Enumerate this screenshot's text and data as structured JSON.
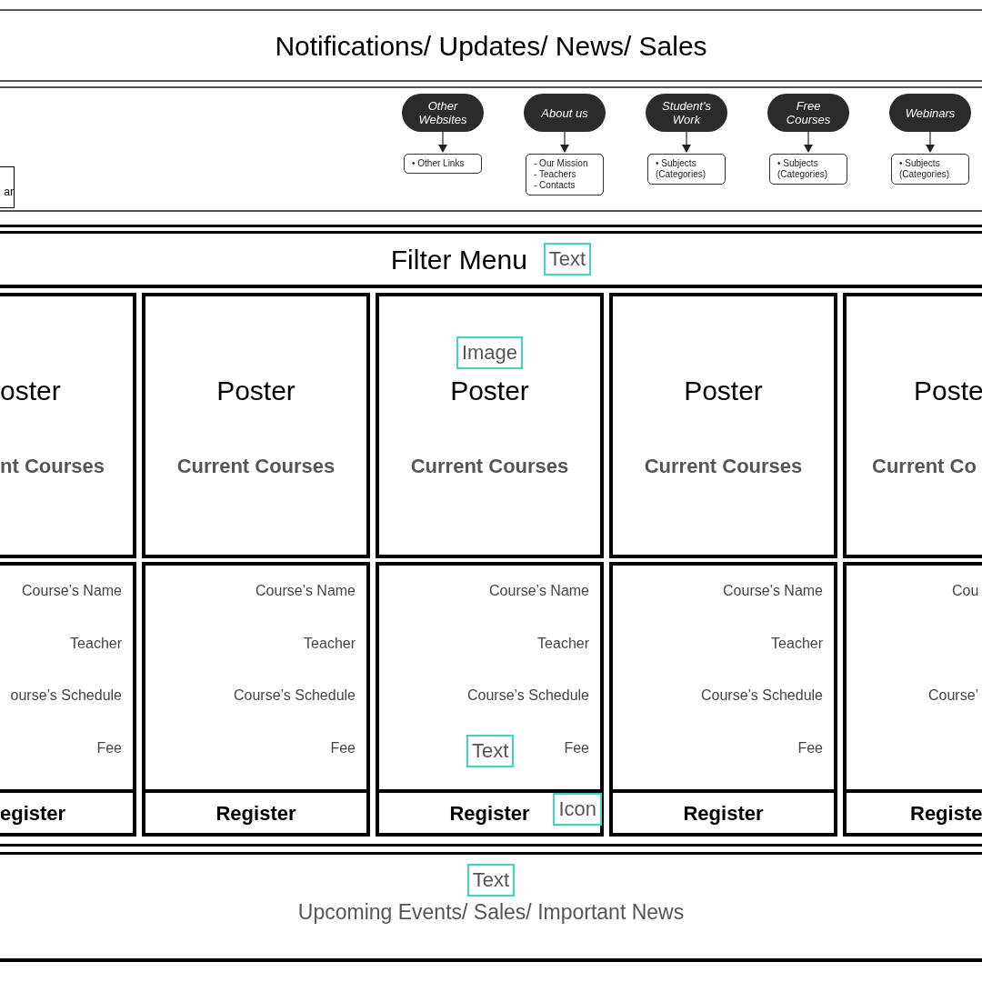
{
  "header": {
    "title": "Notifications/ Updates/ News/ Sales"
  },
  "nav": {
    "left_box": {
      "text": "ar"
    },
    "items": [
      {
        "title": "Other Websites",
        "lines": [
          "• Other Links"
        ]
      },
      {
        "title": "About us",
        "lines": [
          "- Our Mission",
          "- Teachers",
          "- Contacts"
        ]
      },
      {
        "title": "Student's Work",
        "lines": [
          "• Subjects (Categories)"
        ]
      },
      {
        "title": "Free Courses",
        "lines": [
          "• Subjects (Categories)"
        ]
      },
      {
        "title": "Webinars",
        "lines": [
          "• Subjects (Categories)"
        ]
      }
    ]
  },
  "filter": {
    "title": "Filter Menu",
    "note": "Text"
  },
  "cards": [
    {
      "kind": "cut_left",
      "poster": "oster",
      "subtitle": "nt Courses",
      "details": [
        {
          "kind": "name",
          "text": "Course’s Name"
        },
        {
          "kind": "teacher",
          "text": "Teacher"
        },
        {
          "kind": "schedule",
          "text": "ourse’s Schedule"
        },
        {
          "kind": "fee",
          "text": "Fee"
        }
      ],
      "button": "egister"
    },
    {
      "kind": "full",
      "poster": "Poster",
      "subtitle": "Current Courses",
      "details": [
        {
          "kind": "name",
          "text": "Course’s Name"
        },
        {
          "kind": "teacher",
          "text": "Teacher"
        },
        {
          "kind": "schedule",
          "text": "Course’s Schedule"
        },
        {
          "kind": "fee",
          "text": "Fee"
        }
      ],
      "button": "Register"
    },
    {
      "kind": "full",
      "poster": "Poster",
      "subtitle": "Current Courses",
      "details": [
        {
          "kind": "name",
          "text": "Course’s Name"
        },
        {
          "kind": "teacher",
          "text": "Teacher"
        },
        {
          "kind": "schedule",
          "text": "Course’s Schedule"
        },
        {
          "kind": "fee",
          "text": "Fee"
        }
      ],
      "button": "Register",
      "notes": {
        "poster": "Image",
        "details": "Text",
        "button": "Icon"
      }
    },
    {
      "kind": "full",
      "poster": "Poster",
      "subtitle": "Current Courses",
      "details": [
        {
          "kind": "name",
          "text": "Course’s Name"
        },
        {
          "kind": "teacher",
          "text": "Teacher"
        },
        {
          "kind": "schedule",
          "text": "Course’s Schedule"
        },
        {
          "kind": "fee",
          "text": "Fee"
        }
      ],
      "button": "Register"
    },
    {
      "kind": "cut_right",
      "poster": "Poste",
      "subtitle": "Current Co",
      "details": [
        {
          "kind": "name",
          "text": "Cou"
        },
        {
          "kind": "schedule",
          "text": "Course’"
        }
      ],
      "button": "Registe"
    }
  ],
  "footer": {
    "note": "Text",
    "text": "Upcoming Events/ Sales/ Important News"
  }
}
